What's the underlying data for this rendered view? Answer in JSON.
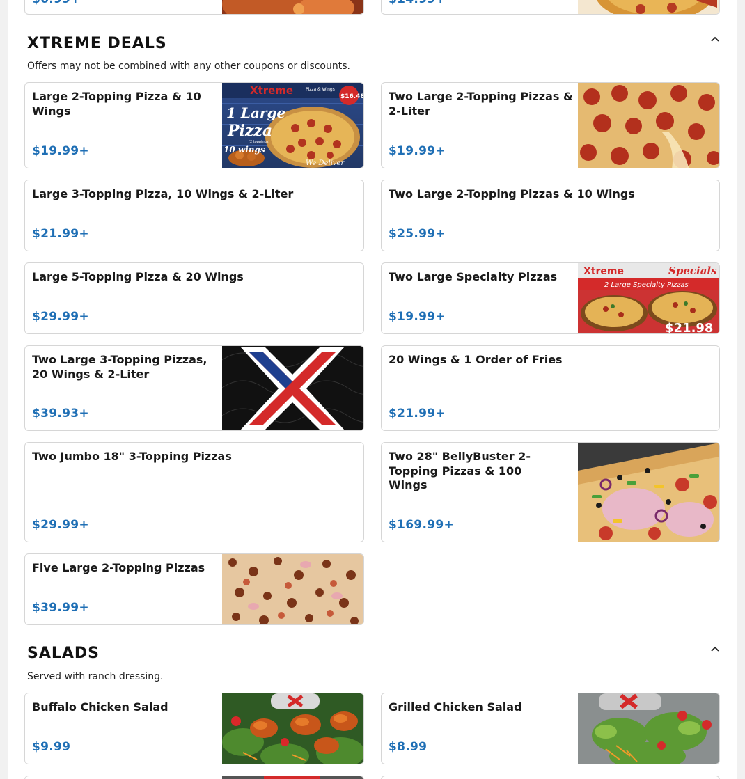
{
  "top_partial": {
    "left_price": "$6.99+",
    "right_price": "$14.99+"
  },
  "xtreme": {
    "title": "XTREME DEALS",
    "description": "Offers may not be combined with any other coupons or discounts.",
    "items": [
      {
        "name": "Large 2-Topping Pizza & 10 Wings",
        "price": "$19.99+"
      },
      {
        "name": "Two Large 2-Topping Pizzas & 2-Liter",
        "price": "$19.99+"
      },
      {
        "name": "Large 3-Topping Pizza, 10 Wings & 2-Liter",
        "price": "$21.99+"
      },
      {
        "name": "Two Large 2-Topping Pizzas & 10 Wings",
        "price": "$25.99+"
      },
      {
        "name": "Large 5-Topping Pizza & 20 Wings",
        "price": "$29.99+"
      },
      {
        "name": "Two Large Specialty Pizzas",
        "price": "$19.99+"
      },
      {
        "name": "Two Large 3-Topping Pizzas, 20 Wings & 2-Liter",
        "price": "$39.93+"
      },
      {
        "name": "20 Wings & 1 Order of Fries",
        "price": "$21.99+"
      },
      {
        "name": "Two Jumbo 18\" 3-Topping Pizzas",
        "price": "$29.99+"
      },
      {
        "name": "Two 28\" BellyBuster 2-Topping Pizzas & 100 Wings",
        "price": "$169.99+"
      },
      {
        "name": "Five Large 2-Topping Pizzas",
        "price": "$39.99+"
      }
    ],
    "image_text": {
      "brand": "Xtreme",
      "brand_sub": "Pizza & Wings",
      "one_large": "1 Large",
      "pizza": "Pizza",
      "toppings": "(2 toppings)",
      "wings": "10 wings",
      "price_badge": "$16.48",
      "deliver": "We Deliver",
      "specials": "Specials",
      "specials_banner": "2 Large Specialty Pizzas",
      "specials_price": "$21.98"
    }
  },
  "salads": {
    "title": "SALADS",
    "description": "Served with ranch dressing.",
    "items": [
      {
        "name": "Buffalo Chicken Salad",
        "price": "$9.99"
      },
      {
        "name": "Grilled Chicken Salad",
        "price": "$8.99"
      }
    ]
  },
  "colors": {
    "price": "#1f6fb5",
    "text": "#1a1a1a",
    "border": "#d6d6d6"
  },
  "icons": {
    "collapse": "chevron-up-icon"
  }
}
